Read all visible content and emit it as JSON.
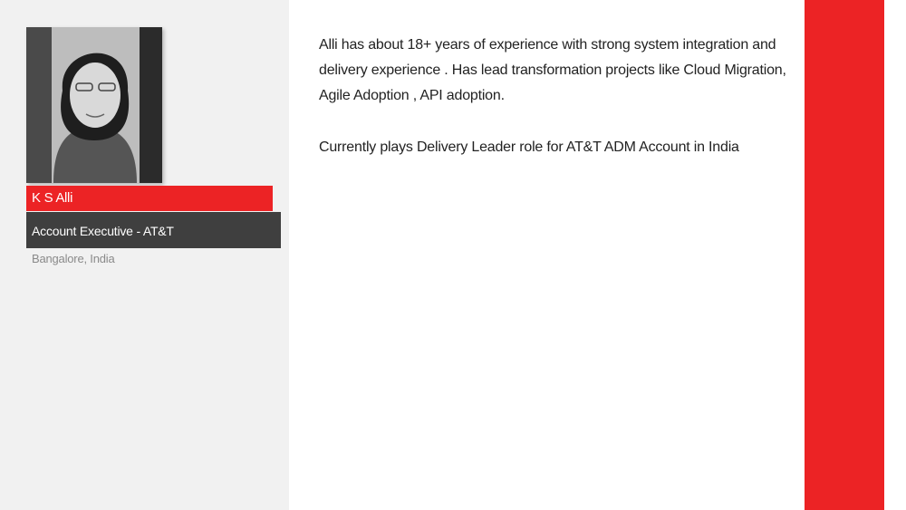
{
  "profile": {
    "name": "K S Alli",
    "title": "Account Executive - AT&T",
    "location": "Bangalore, India",
    "photo_icon": "portrait-photo"
  },
  "bio": {
    "paragraph1": "Alli has about 18+ years of experience with strong system integration and delivery experience . Has lead transformation projects like Cloud Migration, Agile Adoption , API adoption.",
    "paragraph2": "Currently plays Delivery Leader role for AT&T ADM Account in India"
  },
  "colors": {
    "accent": "#ec2325",
    "panel": "#f1f1f1",
    "role_bar": "#3f3f3f"
  }
}
